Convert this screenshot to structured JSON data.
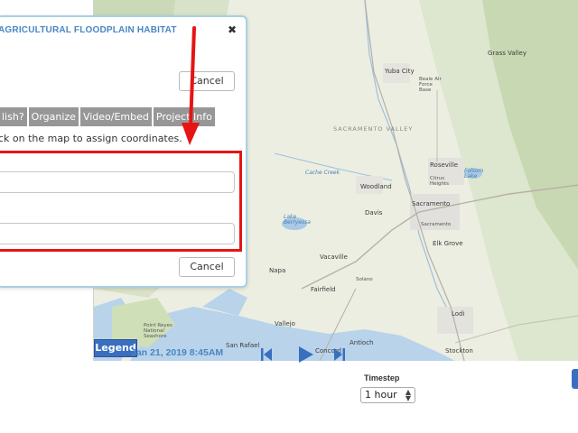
{
  "dialog": {
    "title": "AGRICULTURAL FLOODPLAIN HABITAT",
    "close_glyph": "✖",
    "cancel_top_label": "Cancel",
    "cancel_bottom_label": "Cancel",
    "tabs": [
      "lish?",
      "Organize",
      "Video/Embed",
      "Project Info"
    ],
    "instructions": "ck on the map to assign coordinates.",
    "field_1": {
      "value": "",
      "placeholder": ""
    },
    "field_2": {
      "value": "",
      "placeholder": ""
    }
  },
  "map": {
    "legend_label": "Legend",
    "labels": {
      "grass_valley": "Grass Valley",
      "yuba_city": "Yuba City",
      "beale": "Beale Air Force Base",
      "sacramento_valley": "SACRAMENTO VALLEY",
      "cache_creek": "Cache Creek",
      "roseville": "Roseville",
      "citrus_heights": "Citrus Heights",
      "folsom_lake": "Folsom Lake",
      "woodland": "Woodland",
      "davis": "Davis",
      "sacramento": "Sacramento",
      "sacramento_small": "Sacramento",
      "lake_berryessa": "Lake Berryessa",
      "elk_grove": "Elk Grove",
      "vacaville": "Vacaville",
      "napa": "Napa",
      "fairfield": "Fairfield",
      "solano": "Solano",
      "lodi": "Lodi",
      "vallejo": "Vallejo",
      "point_reyes": "Point Reyes National Seashore",
      "san_rafael": "San Rafael",
      "concord": "Concord",
      "antioch": "Antioch",
      "stockton": "Stockton"
    }
  },
  "timeline": {
    "date": "Jan 21, 2019 8:45AM",
    "timestep_label": "Timestep",
    "timestep_value": "1 hour"
  },
  "icons": {
    "close": "close-icon",
    "skip_back": "skip-back-icon",
    "play": "play-icon",
    "skip_forward": "skip-forward-icon",
    "stepper": "stepper-icon"
  },
  "colors": {
    "accent_blue": "#4a86c3",
    "legend_blue": "#3a6fc0",
    "annotation_red": "#e61414",
    "tab_gray": "#979797",
    "dialog_border": "#a9cfe2"
  }
}
